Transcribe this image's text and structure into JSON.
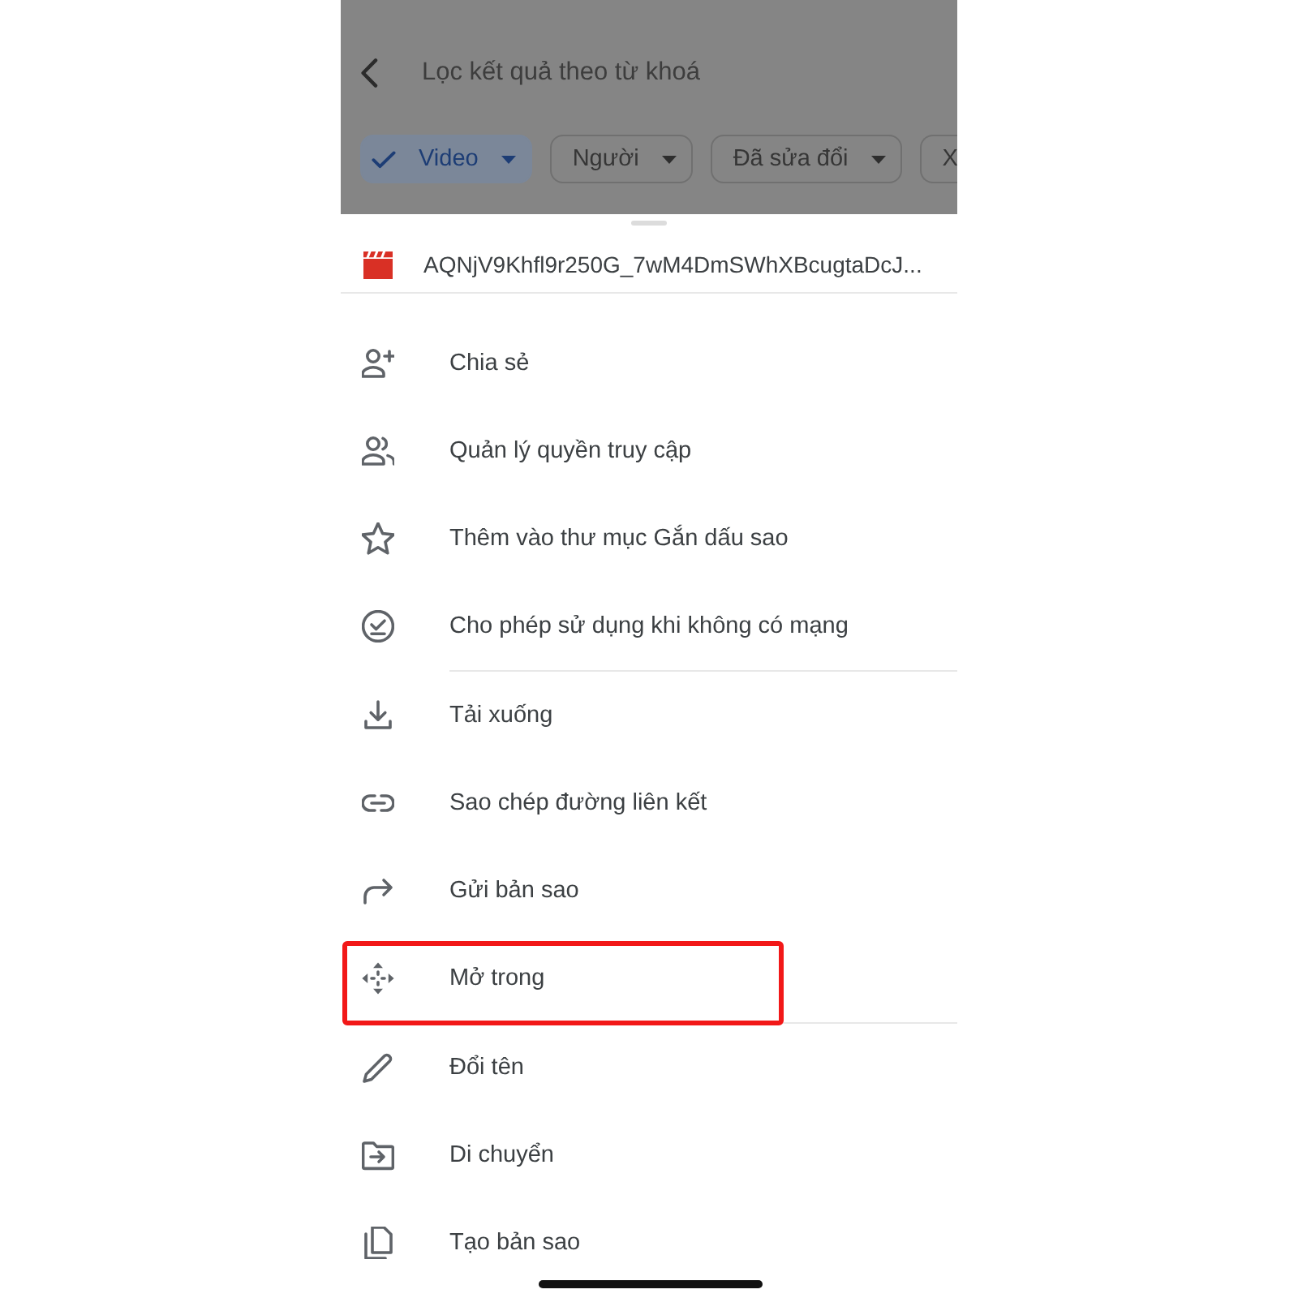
{
  "app_bar": {
    "search": {
      "placeholder": "Lọc kết quả theo từ khoá"
    },
    "filter_chips": [
      {
        "label": "Video",
        "selected": true
      },
      {
        "label": "Người",
        "selected": false
      },
      {
        "label": "Đã sửa đổi",
        "selected": false
      },
      {
        "label": "X",
        "selected": false
      }
    ]
  },
  "sheet": {
    "file_name": "AQNjV9Khfl9r250G_7wM4DmSWhXBcugtaDcJ...",
    "action_groups": [
      {
        "items": [
          {
            "label": "Chia sẻ",
            "highlighted": false
          },
          {
            "label": "Quản lý quyền truy cập",
            "highlighted": false
          },
          {
            "label": "Thêm vào thư mục Gắn dấu sao",
            "highlighted": false
          },
          {
            "label": "Cho phép sử dụng khi không có mạng",
            "highlighted": false
          }
        ]
      },
      {
        "items": [
          {
            "label": "Tải xuống",
            "highlighted": false
          },
          {
            "label": "Sao chép đường liên kết",
            "highlighted": false
          },
          {
            "label": "Gửi bản sao",
            "highlighted": false
          },
          {
            "label": "Mở trong",
            "highlighted": true
          }
        ]
      },
      {
        "items": [
          {
            "label": "Đổi tên",
            "highlighted": false
          },
          {
            "label": "Di chuyển",
            "highlighted": false
          },
          {
            "label": "Tạo bản sao",
            "highlighted": false
          }
        ]
      }
    ]
  }
}
